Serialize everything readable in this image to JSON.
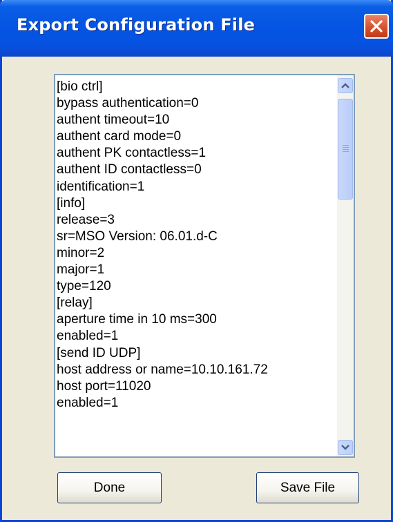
{
  "window": {
    "title": "Export Configuration File"
  },
  "config_text": {
    "lines": [
      "[bio ctrl]",
      "bypass authentication=0",
      "authent timeout=10",
      "authent card mode=0",
      "authent PK contactless=1",
      "authent ID contactless=0",
      "identification=1",
      "[info]",
      "release=3",
      "sr=MSO Version: 06.01.d-C",
      "minor=2",
      "major=1",
      "type=120",
      "[relay]",
      "aperture time in 10 ms=300",
      "enabled=1",
      "[send ID UDP]",
      "host address or name=10.10.161.72",
      "host port=11020",
      "enabled=1"
    ]
  },
  "buttons": {
    "done_label": "Done",
    "save_label": "Save File"
  },
  "icons": {
    "close": "close-icon",
    "scroll_up": "chevron-up-icon",
    "scroll_down": "chevron-down-icon"
  },
  "colors": {
    "titlebar": "#0554e3",
    "close_button": "#d6522e",
    "dialog_background": "#ece9d8",
    "text_background": "#ffffff"
  }
}
